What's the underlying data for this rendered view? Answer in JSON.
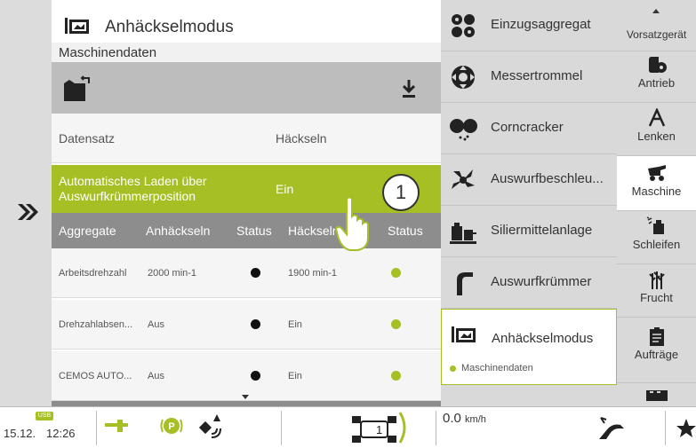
{
  "page": {
    "title": "Anhäckselmodus",
    "subtitle": "Maschinendaten"
  },
  "dataset": {
    "label": "Datensatz",
    "value": "Häckseln"
  },
  "auto_load": {
    "label": "Automatisches Laden über Auswurfkrümmerposition",
    "value": "Ein",
    "callout": "1"
  },
  "table": {
    "headers": [
      "Aggregate",
      "Anhäckseln",
      "Status",
      "Häckseln",
      "Status"
    ],
    "rows": [
      {
        "aggregate": "Arbeitsdrehzahl",
        "anhaeckseln": "2000 min-1",
        "status1": "black",
        "haeckseln": "1900 min-1",
        "status2": "green"
      },
      {
        "aggregate": "Drehzahlabsen...",
        "anhaeckseln": "Aus",
        "status1": "black",
        "haeckseln": "Ein",
        "status2": "green"
      },
      {
        "aggregate": "CEMOS AUTO...",
        "anhaeckseln": "Aus",
        "status1": "black",
        "haeckseln": "Ein",
        "status2": "green"
      }
    ]
  },
  "menu": {
    "items": [
      {
        "label": "Einzugsaggregat",
        "icon": "intake-icon"
      },
      {
        "label": "Messertrommel",
        "icon": "cutter-drum-icon"
      },
      {
        "label": "Corncracker",
        "icon": "corncracker-icon"
      },
      {
        "label": "Auswurfbeschleu...",
        "icon": "accelerator-icon"
      },
      {
        "label": "Siliermittelanlage",
        "icon": "silage-agent-icon"
      },
      {
        "label": "Auswurfkrümmer",
        "icon": "spout-icon"
      },
      {
        "label": "Anhäckselmodus",
        "icon": "opening-cut-icon",
        "sub": "Maschinendaten"
      }
    ]
  },
  "right_nav": {
    "items": [
      {
        "label": "Vorsatzgerät"
      },
      {
        "label": "Antrieb"
      },
      {
        "label": "Lenken"
      },
      {
        "label": "Maschine"
      },
      {
        "label": "Schleifen"
      },
      {
        "label": "Frucht"
      },
      {
        "label": "Aufträge"
      }
    ]
  },
  "status": {
    "usb": "USB",
    "date": "15.12.",
    "time": "12:26",
    "gear": "1",
    "speed": "0.0",
    "speed_unit": "km/h"
  },
  "colors": {
    "accent": "#a6bf25",
    "header_gray": "#8d8d8d",
    "panel_gray": "#d9d9d9"
  }
}
